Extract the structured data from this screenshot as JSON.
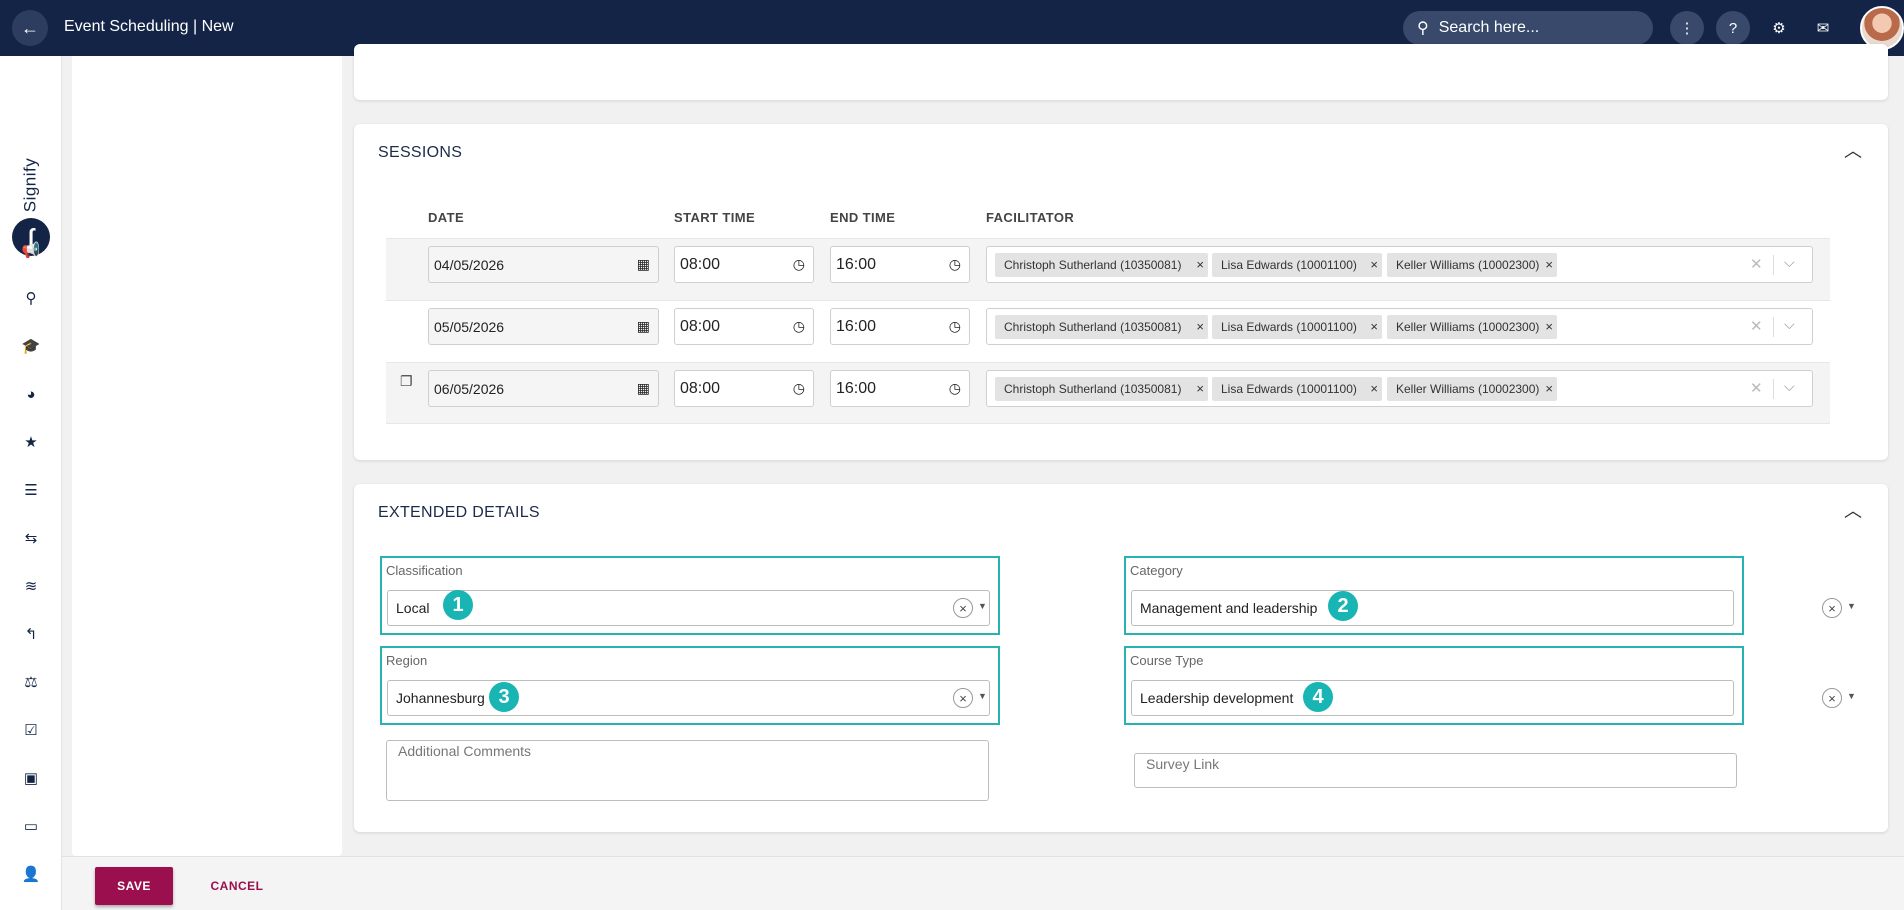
{
  "topbar": {
    "title": "Event Scheduling | New",
    "search_placeholder": "Search here..."
  },
  "sessions": {
    "title": "SESSIONS",
    "headers": {
      "date": "DATE",
      "start": "START TIME",
      "end": "END TIME",
      "facilitator": "FACILITATOR"
    },
    "rows": [
      {
        "date": "04/05/2026",
        "start": "08:00",
        "end": "16:00",
        "facilitators": [
          "Christoph Sutherland (10350081)",
          "Lisa Edwards (10001100)",
          "Keller Williams (10002300)"
        ]
      },
      {
        "date": "05/05/2026",
        "start": "08:00",
        "end": "16:00",
        "facilitators": [
          "Christoph Sutherland (10350081)",
          "Lisa Edwards (10001100)",
          "Keller Williams (10002300)"
        ]
      },
      {
        "date": "06/05/2026",
        "start": "08:00",
        "end": "16:00",
        "facilitators": [
          "Christoph Sutherland (10350081)",
          "Lisa Edwards (10001100)",
          "Keller Williams (10002300)"
        ]
      }
    ]
  },
  "extended": {
    "title": "EXTENDED DETAILS",
    "classification": {
      "label": "Classification",
      "value": "Local",
      "badge": "1"
    },
    "category": {
      "label": "Category",
      "value": "Management and leadership",
      "badge": "2"
    },
    "region": {
      "label": "Region",
      "value": "Johannesburg",
      "badge": "3"
    },
    "course_type": {
      "label": "Course Type",
      "value": "Leadership development",
      "badge": "4"
    },
    "comments_placeholder": "Additional Comments",
    "survey_placeholder": "Survey Link"
  },
  "footer": {
    "save_label": "SAVE",
    "cancel_label": "CANCEL"
  },
  "colors": {
    "navy": "#132446",
    "accent": "#9c0f4e",
    "highlight": "#26b3b1"
  }
}
